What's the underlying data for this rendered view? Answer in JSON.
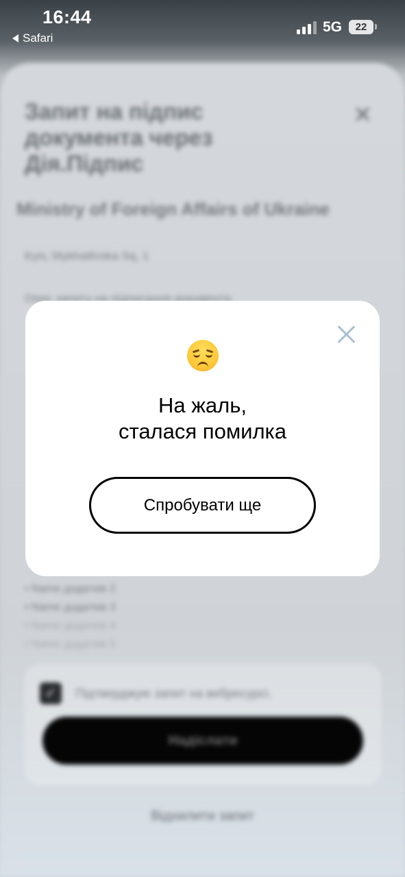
{
  "status_bar": {
    "time": "16:44",
    "back_app": "Safari",
    "network": "5G",
    "battery": "22"
  },
  "background": {
    "title": "Запит на підпис документа через Дія.Підпис",
    "organization": "Ministry of Foreign Affairs of Ukraine",
    "address": "Kyiv, Mykhailivska Sq, 1",
    "description": "Опис запиту на підписання документа",
    "attachments": [
      "Name додатків 2",
      "Name додатків 3",
      "Name додатків 4",
      "Name додатків 5"
    ],
    "confirm_label": "Підтверджую запит на вебресурсі.",
    "send_label": "Надіслати",
    "reject_label": "Відхилити запит"
  },
  "modal": {
    "emoji": "disappointed-face",
    "title_line1": "На жаль,",
    "title_line2": "сталася помилка",
    "retry_label": "Спробувати ще",
    "close_color": "#a9bfcf"
  }
}
